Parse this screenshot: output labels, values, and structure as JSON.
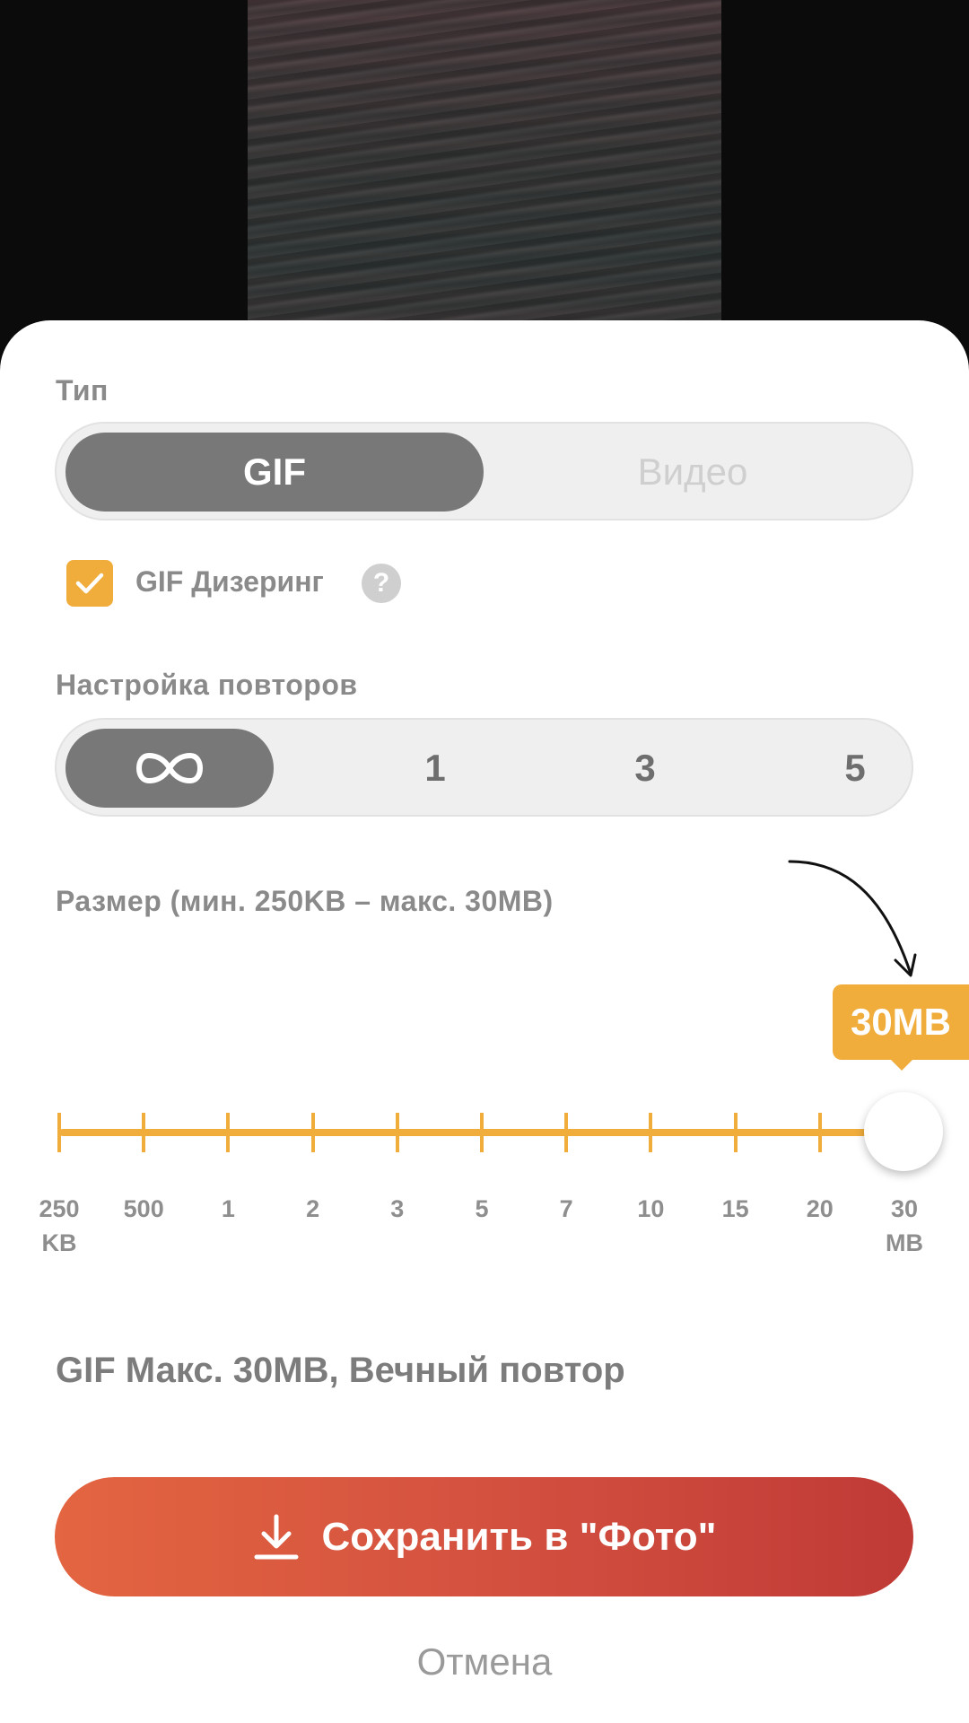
{
  "type_section": {
    "label": "Тип",
    "options": [
      "GIF",
      "Видео"
    ],
    "selected": "GIF"
  },
  "dithering": {
    "label": "GIF Дизеринг",
    "checked": true,
    "help_icon": "question-icon",
    "help_glyph": "?"
  },
  "repeat_section": {
    "label": "Настройка повторов",
    "options": [
      "∞",
      "1",
      "3",
      "5"
    ],
    "selected": "∞"
  },
  "size_section": {
    "label": "Размер (мин. 250KB – макс. 30MB)",
    "tooltip": "30MB",
    "ticks": [
      {
        "top": "250",
        "bottom": "KB"
      },
      {
        "top": "500"
      },
      {
        "top": "1"
      },
      {
        "top": "2"
      },
      {
        "top": "3"
      },
      {
        "top": "5"
      },
      {
        "top": "7"
      },
      {
        "top": "10"
      },
      {
        "top": "15"
      },
      {
        "top": "20"
      },
      {
        "top": "30",
        "bottom": "MB"
      }
    ],
    "selected_index": 10
  },
  "summary": "GIF Макс. 30MB, Вечный повтор",
  "save_button": {
    "label": "Сохранить в \"Фото\"",
    "icon": "download-icon"
  },
  "cancel_button": {
    "label": "Отмена"
  },
  "colors": {
    "accent": "#f0ad3c",
    "button_start": "#e36541",
    "button_end": "#c03a36",
    "segment_active": "#787878"
  }
}
